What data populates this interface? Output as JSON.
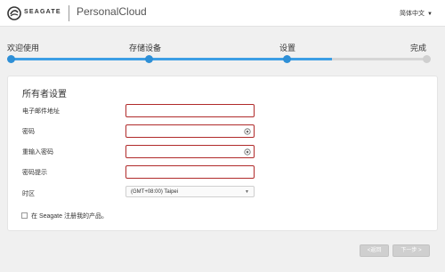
{
  "header": {
    "brand": "SEAGATE",
    "product": "PersonalCloud",
    "language": "简体中文",
    "caret": "▼"
  },
  "steps": [
    {
      "label": "欢迎使用",
      "status": "done"
    },
    {
      "label": "存储设备",
      "status": "done"
    },
    {
      "label": "设置",
      "status": "done"
    },
    {
      "label": "完成",
      "status": "todo"
    }
  ],
  "progress": 0.77,
  "form": {
    "title": "所有者设置",
    "email_label": "电子邮件地址",
    "password_label": "密码",
    "confirm_label": "重输入密码",
    "hint_label": "密码提示",
    "timezone_label": "时区",
    "timezone_value": "(GMT+08:00) Taipei",
    "register_label": "在 Seagate 注册我的产品。"
  },
  "buttons": {
    "back": "<返回",
    "next": "下一步 >"
  },
  "colors": {
    "accent": "#2e8fd6",
    "error_border": "#b02a2a",
    "disabled_button": "#cfcfcf"
  }
}
